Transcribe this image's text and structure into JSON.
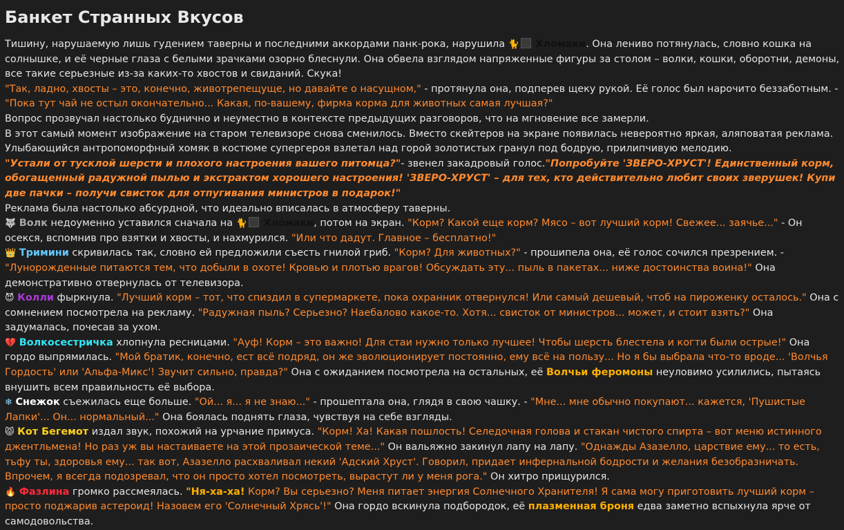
{
  "title": "Банкет Странных Вкусов",
  "p1": {
    "t1": "Тишину, нарушаемую лишь гудением таверны и последними аккордами панк-рока, нарушила ",
    "icon": "🐈",
    "name": "Хломаки",
    "t2": ". Она лениво потянулась, словно кошка на солнышке, и её черные глаза с белыми зрачками озорно блеснули. Она обвела взглядом напряженные фигуры за столом – волки, кошки, оборотни, демоны, все такие серьезные из-за каких-то хвостов и свиданий. Скука!"
  },
  "p2": {
    "q1": "\"Так, ладно, хвосты – это, конечно, животрепещуще, но давайте о насущном,\"",
    "t1": " - протянула она, подперев щеку рукой. Её голос был нарочито беззаботным. - ",
    "q2": "\"Пока тут чай не остыл окончательно... Какая, по-вашему, фирма корма для животных самая лучшая?\""
  },
  "p3": "Вопрос прозвучал настолько буднично и неуместно в контексте предыдущих разговоров, что на мгновение все замерли.",
  "p4": "В этот самый момент изображение на старом телевизоре снова сменилось. Вместо скейтеров на экране появилась невероятно яркая, аляповатая реклама. Улыбающийся антропоморфный хомяк в костюме супергероя взлетал над горой золотистых гранул под бодрую, прилипчивую мелодию.",
  "p5": {
    "q1": "\"Устали от тусклой шерсти и плохого настроения вашего питомца?\"",
    "t1": "- звенел закадровый голос.",
    "q2": "\"Попробуйте 'ЗВЕРО-ХРУСТ'! Единственный корм, обогащенный радужной пылью и экстрактом хорошего настроения! 'ЗВЕРО-ХРУСТ' – для тех, кто действительно любит своих зверушек! Купи две пачки – получи свисток для отпугивания министров в подарок!\""
  },
  "p6": "Реклама была настолько абсурдной, что идеально вписалась в атмосферу таверны.",
  "wolf": {
    "icon": "🐺",
    "name": "Волк",
    "t1": " недоуменно уставился сначала на ",
    "cat_icon": "🐈",
    "cat_name": "Хломаки",
    "t2": ", потом на экран. ",
    "q1": "\"Корм? Какой еще корм? Мясо – вот лучший корм! Свежее... заячье...\"",
    "t3": " - Он осекся, вспомнив про взятки и хвосты, и нахмурился. ",
    "q2": "\"Или что дадут. Главное – бесплатно!\""
  },
  "trimini": {
    "icon": "👑",
    "name": "Тримини",
    "t1": " скривилась так, словно ей предложили съесть гнилой гриб. ",
    "q1": "\"Корм? Для животных?\"",
    "t2": " - прошипела она, её голос сочился презрением. - ",
    "q2": "\"Лунорожденные питаются тем, что добыли в охоте! Кровью и плотью врагов! Обсуждать эту... пыль в пакетах... ниже достоинства воина!\"",
    "t3": " Она демонстративно отвернулась от телевизора."
  },
  "kolli": {
    "icon": "😈",
    "name": "Колли",
    "t1": " фыркнула. ",
    "q1": "\"Лучший корм – тот, что спиздил в супермаркете, пока охранник отвернулся! Или самый дешевый, чтоб на пироженку осталось.\"",
    "t2": " Она с сомнением посмотрела на рекламу. ",
    "q2": "\"Радужная пыль? Серьезно? Наебалово какое-то. Хотя... свисток от министров... может, и стоит взять?\"",
    "t3": " Она задумалась, почесав за ухом."
  },
  "volko": {
    "icon": "💔",
    "name": "Волкосестричка",
    "t1": " хлопнула ресницами. ",
    "q1": "\"Ауф! Корм – это важно! Для стаи нужно только лучшее! Чтобы шерсть блестела и когти были острые!\"",
    "t2": " Она гордо выпрямилась. ",
    "q2": "\"Мой братик, конечно, ест всё подряд, он же эволюционирует постоянно, ему всё на пользу... Но я бы выбрала что-то вроде... 'Волчья Гордость' или 'Альфа-Микс'! Звучит сильно, правда?\"",
    "t3": " Она с ожиданием посмотрела на остальных, её ",
    "hl": "Волчьи феромоны",
    "t4": " неуловимо усилились, пытаясь внушить всем правильность её выбора."
  },
  "snez": {
    "icon": "❄",
    "name": "Снежок",
    "t1": " съежилась еще больше. ",
    "q1": "\"Ой... я... я не знаю...\"",
    "t2": " - прошептала она, глядя в свою чашку. - ",
    "q2": "\"Мне... мне обычно покупают... кажется, 'Пушистые Лапки'... Он... нормальный...\"",
    "t3": " Она боялась поднять глаза, чувствуя на себе взгляды."
  },
  "kot": {
    "icon": "😾",
    "name": "Кот Бегемот",
    "t1": " издал звук, похожий на урчание примуса. ",
    "q1": "\"Корм! Ха! Какая пошлость! Селедочная голова и стакан чистого спирта – вот меню истинного джентльмена! Но раз уж вы настаиваете на этой прозаической теме...\"",
    "t2": " Он вальяжно закинул лапу на лапу. ",
    "q2": "\"Однажды Азазелло, царствие ему... то есть, тьфу ты, здоровья ему... так вот, Азазелло расхваливал некий 'Адский Хруст'. Говорил, придает инфернальной бодрости и желания безобразничать. Впрочем, я всегда подозревал, что он просто хотел посмотреть, вырастут ли у меня рога.\"",
    "t3": " Он хитро прищурился."
  },
  "faz": {
    "icon": "🔥",
    "name": "Фазлина",
    "t1": " громко рассмеялась. ",
    "qh": "\"Ня-ха-ха!",
    "q1": " Корм? Вы серьезно? Меня питает энергия Солнечного Хранителя! Я сама могу приготовить лучший корм – просто поджарив астероид! Назовем его 'Солнечный Хрясь'!\"",
    "t2": " Она гордо вскинула подбородок, её ",
    "hl": "плазменная броня",
    "t3": " едва заметно вспыхнула ярче от самодовольства."
  },
  "colors": {
    "background": "#1e1e1e",
    "text": "#e4e4e4",
    "quote": "#ff8a30",
    "wolf": "#a8a8a8",
    "trimini": "#64c8ff",
    "kolli": "#a83ad6",
    "volkosestrichka": "#32e6f6",
    "kot": "#ffd21e",
    "fazlina": "#ff2a3a",
    "highlight": "#ffb000"
  }
}
